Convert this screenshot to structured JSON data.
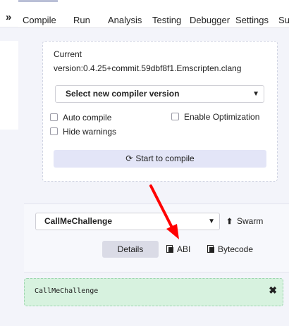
{
  "tabs": [
    {
      "label": "Compile",
      "active": true
    },
    {
      "label": "Run",
      "active": false
    },
    {
      "label": "Analysis",
      "active": false
    },
    {
      "label": "Testing",
      "active": false
    },
    {
      "label": "Debugger",
      "active": false
    },
    {
      "label": "Settings",
      "active": false
    },
    {
      "label": "Sup",
      "active": false
    }
  ],
  "collapse_icon": "double-chevron-right-icon",
  "compiler": {
    "current_label": "Current",
    "current_version": "version:0.4.25+commit.59dbf8f1.Emscripten.clang",
    "select_label": "Select new compiler version",
    "auto_compile": {
      "label": "Auto compile",
      "checked": false
    },
    "enable_optimization": {
      "label": "Enable Optimization",
      "checked": false
    },
    "hide_warnings": {
      "label": "Hide warnings",
      "checked": false
    },
    "compile_button": "Start to compile"
  },
  "contract": {
    "selected": "CallMeChallenge",
    "swarm_label": "Swarm",
    "details_label": "Details",
    "abi_label": "ABI",
    "bytecode_label": "Bytecode"
  },
  "alert": {
    "text": "CallMeChallenge"
  },
  "colors": {
    "panel_bg": "#f3f4fa",
    "compile_button_bg": "#e3e5f7",
    "alert_bg": "#d7f2df",
    "annotation_arrow": "#ff0000"
  }
}
